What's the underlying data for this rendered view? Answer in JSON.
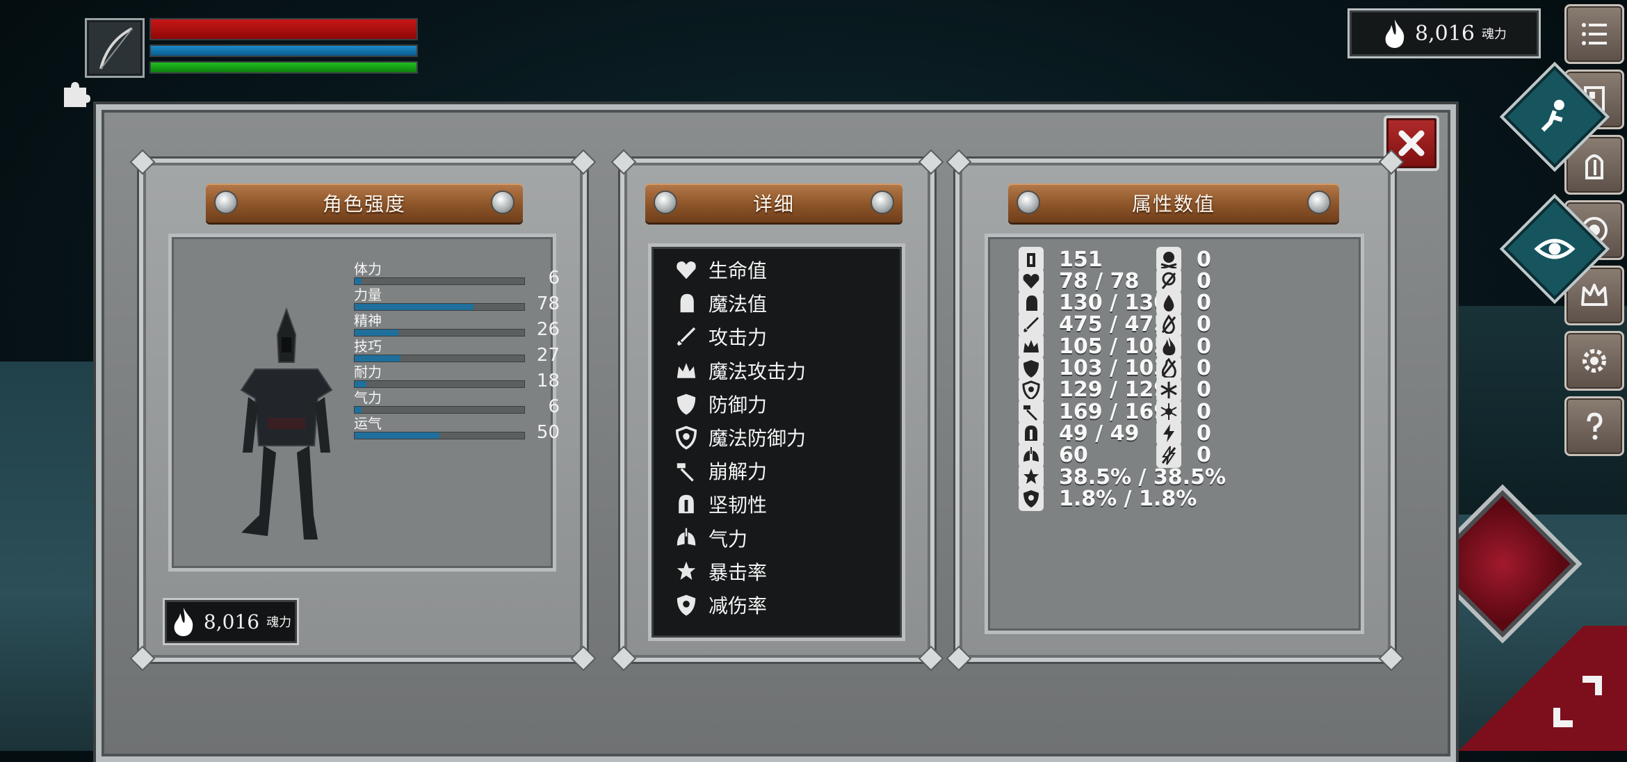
{
  "hud": {
    "hp_ratio": 1.0,
    "mp_ratio": 1.0,
    "stamina_ratio": 1.0,
    "soul_value": "8,016",
    "soul_unit": "魂力"
  },
  "panels": {
    "strength": {
      "title": "角色强度",
      "stats": [
        {
          "name": "体力",
          "value": "6",
          "fill": 0.04
        },
        {
          "name": "力量",
          "value": "78",
          "fill": 0.7
        },
        {
          "name": "精神",
          "value": "26",
          "fill": 0.26
        },
        {
          "name": "技巧",
          "value": "27",
          "fill": 0.27
        },
        {
          "name": "耐力",
          "value": "18",
          "fill": 0.07
        },
        {
          "name": "气力",
          "value": "6",
          "fill": 0.04
        },
        {
          "name": "运气",
          "value": "50",
          "fill": 0.5
        }
      ],
      "soul_value": "8,016",
      "soul_unit": "魂力"
    },
    "detail": {
      "title": "详细",
      "items": [
        {
          "label": "生命值",
          "icon": "heart-icon"
        },
        {
          "label": "魔法值",
          "icon": "head-icon"
        },
        {
          "label": "攻击力",
          "icon": "sword-icon"
        },
        {
          "label": "魔法攻击力",
          "icon": "magic-crown-icon"
        },
        {
          "label": "防御力",
          "icon": "shield-icon"
        },
        {
          "label": "魔法防御力",
          "icon": "magic-shield-icon"
        },
        {
          "label": "崩解力",
          "icon": "hammer-icon"
        },
        {
          "label": "坚韧性",
          "icon": "helmet-icon"
        },
        {
          "label": "气力",
          "icon": "lungs-icon"
        },
        {
          "label": "暴击率",
          "icon": "crit-star-icon"
        },
        {
          "label": "减伤率",
          "icon": "damage-reduction-icon"
        }
      ]
    },
    "attributes": {
      "title": "属性数值",
      "left": [
        {
          "value": "151",
          "icon": "armor-weight-icon"
        },
        {
          "value": "78 / 78",
          "icon": "heart-icon"
        },
        {
          "value": "130 / 130",
          "icon": "head-icon"
        },
        {
          "value": "475 / 475",
          "icon": "sword-icon"
        },
        {
          "value": "105 / 105",
          "icon": "magic-crown-icon"
        },
        {
          "value": "103 / 103",
          "icon": "shield-icon"
        },
        {
          "value": "129 / 129",
          "icon": "magic-shield-icon"
        },
        {
          "value": "169 / 169",
          "icon": "hammer-icon"
        },
        {
          "value": "49 / 49",
          "icon": "helmet-icon"
        },
        {
          "value": "60",
          "icon": "lungs-icon"
        },
        {
          "value": "38.5% / 38.5%",
          "icon": "crit-star-icon"
        },
        {
          "value": "1.8% / 1.8%",
          "icon": "damage-reduction-icon"
        }
      ],
      "right": [
        {
          "value": "0",
          "icon": "skull-icon"
        },
        {
          "value": "0",
          "icon": "skull-resist-icon"
        },
        {
          "value": "0",
          "icon": "poison-drop-icon"
        },
        {
          "value": "0",
          "icon": "poison-resist-icon"
        },
        {
          "value": "0",
          "icon": "fire-icon"
        },
        {
          "value": "0",
          "icon": "fire-resist-icon"
        },
        {
          "value": "0",
          "icon": "frost-icon"
        },
        {
          "value": "0",
          "icon": "frost-resist-icon"
        },
        {
          "value": "0",
          "icon": "lightning-icon"
        },
        {
          "value": "0",
          "icon": "lightning-resist-icon"
        }
      ]
    }
  },
  "side_menu": [
    "menu-icon",
    "character-icon",
    "equipment-icon",
    "skills-icon",
    "crown-icon",
    "settings-icon",
    "help-icon"
  ],
  "colors": {
    "hp": "#c81717",
    "mp": "#1b8ac9",
    "stamina": "#1fbf1f",
    "plank": "#8c5428",
    "stat_bar": "#1f6f9c"
  }
}
